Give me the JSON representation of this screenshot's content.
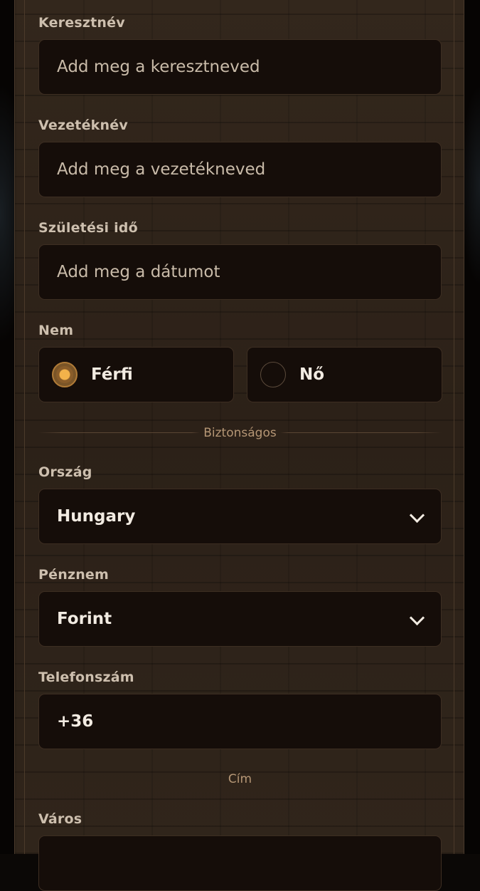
{
  "fields": {
    "first_name": {
      "label": "Keresztnév",
      "placeholder": "Add meg a keresztneved"
    },
    "last_name": {
      "label": "Vezetéknév",
      "placeholder": "Add meg a vezetékneved"
    },
    "birth_date": {
      "label": "Születési idő",
      "placeholder": "Add meg a dátumot"
    },
    "gender": {
      "label": "Nem",
      "options": [
        "Férfi",
        "Nő"
      ],
      "selected": "Férfi"
    },
    "security_divider": "Biztonságos",
    "country": {
      "label": "Ország",
      "value": "Hungary"
    },
    "currency": {
      "label": "Pénznem",
      "value": "Forint"
    },
    "phone": {
      "label": "Telefonszám",
      "value": "+36"
    },
    "address_divider": "Cím",
    "city": {
      "label": "Város"
    }
  },
  "colors": {
    "accent": "#f0a43a",
    "panel_bg": "#2f241a",
    "input_bg": "#150d09",
    "label_text": "#cdbfae",
    "value_text": "#f2ebe2",
    "divider_text": "#b59675"
  },
  "icons": [
    "chevron-down-icon",
    "radio-selected-icon",
    "radio-unselected-icon"
  ]
}
